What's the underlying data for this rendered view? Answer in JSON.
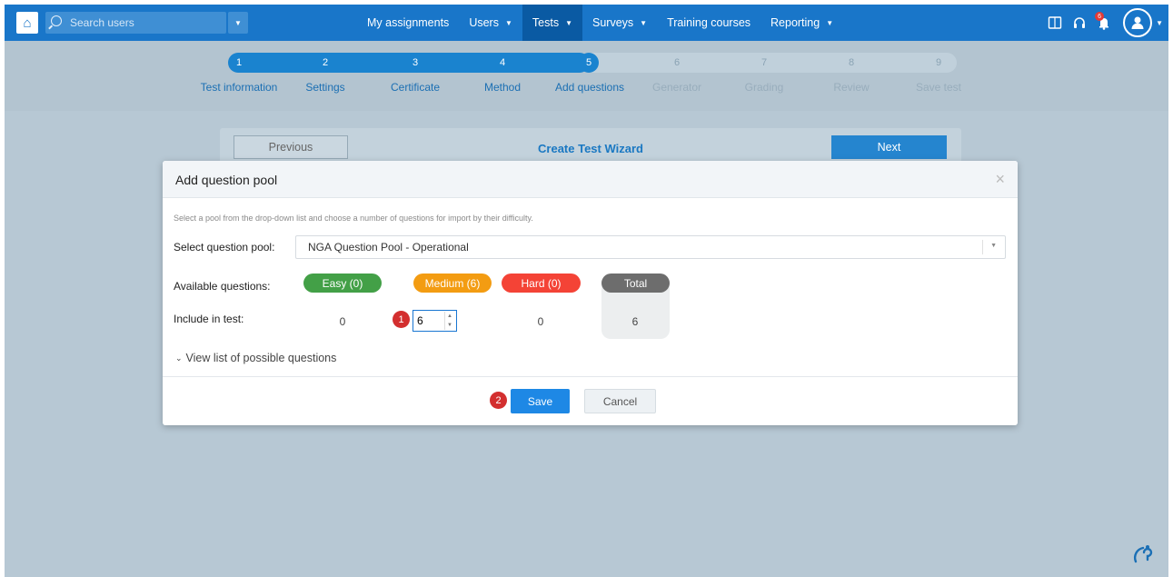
{
  "nav": {
    "search_placeholder": "Search users",
    "items": [
      {
        "label": "My assignments",
        "caret": false,
        "active": false
      },
      {
        "label": "Users",
        "caret": true,
        "active": false
      },
      {
        "label": "Tests",
        "caret": true,
        "active": true
      },
      {
        "label": "Surveys",
        "caret": true,
        "active": false
      },
      {
        "label": "Training courses",
        "caret": false,
        "active": false
      },
      {
        "label": "Reporting",
        "caret": true,
        "active": false
      }
    ],
    "notification_count": "6"
  },
  "stepper": {
    "steps": [
      {
        "num": "1",
        "label": "Test information"
      },
      {
        "num": "2",
        "label": "Settings"
      },
      {
        "num": "3",
        "label": "Certificate"
      },
      {
        "num": "4",
        "label": "Method"
      },
      {
        "num": "5",
        "label": "Add questions"
      },
      {
        "num": "6",
        "label": "Generator"
      },
      {
        "num": "7",
        "label": "Grading"
      },
      {
        "num": "8",
        "label": "Review"
      },
      {
        "num": "9",
        "label": "Save test"
      }
    ],
    "current": 5
  },
  "wizard": {
    "prev_label": "Previous",
    "title": "Create Test Wizard",
    "next_label": "Next"
  },
  "modal": {
    "title": "Add question pool",
    "close": "×",
    "hint": "Select a pool from the drop-down list and choose a number of questions for import by their difficulty.",
    "select_label": "Select question pool:",
    "select_value": "NGA Question Pool - Operational",
    "available_label": "Available questions:",
    "include_label": "Include in test:",
    "easy_label": "Easy (0)",
    "medium_label": "Medium (6)",
    "hard_label": "Hard (0)",
    "total_label": "Total",
    "easy_include": "0",
    "medium_include": "6",
    "hard_include": "0",
    "total_include": "6",
    "view_list": "View list of possible questions",
    "save_label": "Save",
    "cancel_label": "Cancel",
    "marker1": "1",
    "marker2": "2"
  },
  "colors": {
    "nav_bg": "#1976c9",
    "easy": "#43a047",
    "medium": "#f39c12",
    "hard": "#f44336",
    "total": "#6d6d6d",
    "primary": "#1e88e5"
  }
}
